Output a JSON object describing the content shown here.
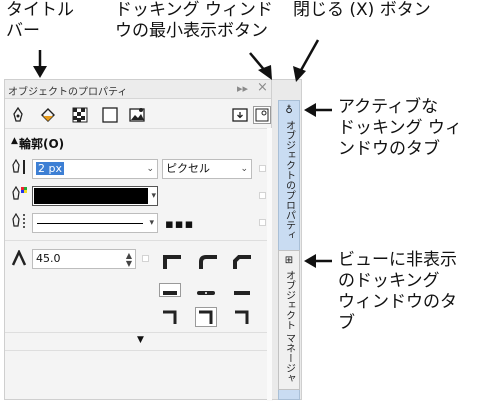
{
  "callouts": {
    "title_bar": "タイトル\nバー",
    "minimize": "ドッキング ウィンド\nウの最小表示ボタン",
    "close": "閉じる (X) ボタン",
    "active_tab": "アクティブな\nドッキング ウィ\nンドウのタブ",
    "hidden_tab": "ビューに非表示\nのドッキング\nウィンドウのタ\nブ"
  },
  "panel": {
    "title": "オブジェクトのプロパティ",
    "minimize_glyph": "▸▸",
    "close_glyph": "×"
  },
  "toolbar": {
    "icons": [
      "outline-pen-icon",
      "fill-icon",
      "pattern-fill-icon",
      "transparency-icon",
      "image-icon",
      "panel-options-icon",
      "docker-icon"
    ]
  },
  "outline": {
    "section_title": "輪郭(O)",
    "width_value": "2 px",
    "units_value": "ピクセル",
    "color_value": "#000000",
    "miter_value": "45.0",
    "more_glyph": "▪▪▪"
  },
  "tabs": {
    "active_label": "オブジェクトのプロパティ",
    "hidden_label": "オブジェクト マネージャ"
  }
}
